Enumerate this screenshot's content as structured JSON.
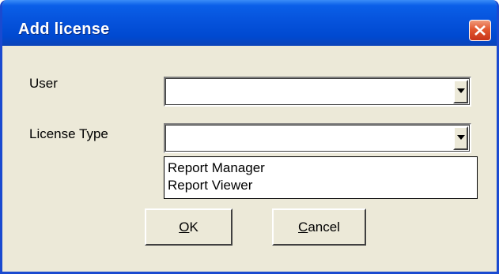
{
  "window": {
    "title": "Add license"
  },
  "form": {
    "user_label": "User",
    "user_value": "",
    "license_type_label": "License Type",
    "license_type_value": ""
  },
  "license_type_options": [
    "Report Manager",
    "Report Viewer"
  ],
  "buttons": {
    "ok_mnemonic": "O",
    "ok_rest": "K",
    "cancel_mnemonic": "C",
    "cancel_rest": "ancel"
  },
  "icons": {
    "close": "close-icon",
    "dropdown": "chevron-down-icon"
  },
  "colors": {
    "titlebar": "#0653dc",
    "close_button": "#e2572f",
    "dialog_face": "#ece9d8"
  }
}
